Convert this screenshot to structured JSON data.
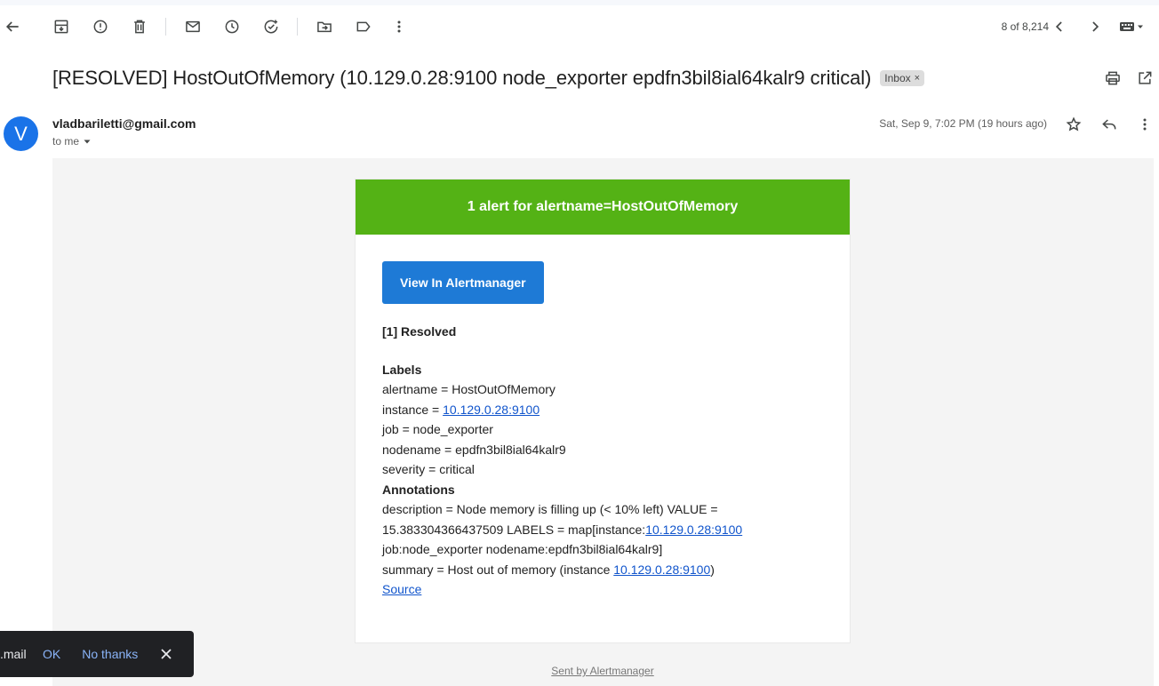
{
  "toolbar": {
    "pager_text": "8 of 8,214"
  },
  "message": {
    "subject": "[RESOLVED] HostOutOfMemory (10.129.0.28:9100 node_exporter epdfn3bil8ial64kalr9 critical)",
    "label": "Inbox",
    "label_remove": "×",
    "avatar_letter": "V",
    "sender": "vladbariletti@gmail.com",
    "to": "to me",
    "date": "Sat, Sep 9, 7:02 PM (19 hours ago)"
  },
  "alert": {
    "header": "1 alert for alertname=HostOutOfMemory",
    "button": "View In Alertmanager",
    "resolved": "[1] Resolved",
    "labels_heading": "Labels",
    "alertname_line": "alertname = HostOutOfMemory",
    "instance_prefix": "instance = ",
    "instance_link": "10.129.0.28:9100",
    "job_line": "job = node_exporter",
    "nodename_line": "nodename = epdfn3bil8ial64kalr9",
    "severity_line": "severity = critical",
    "annotations_heading": "Annotations",
    "description_1": "description = Node memory is filling up (< 10% left) VALUE =",
    "description_2_prefix": "15.383304366437509 LABELS = map[instance:",
    "description_2_link": "10.129.0.28:9100",
    "description_3": "job:node_exporter nodename:epdfn3bil8ial64kalr9]",
    "summary_prefix": "summary = Host out of memory (instance ",
    "summary_link": "10.129.0.28:9100",
    "summary_suffix": ")",
    "source_link": "Source",
    "footer": "Sent by Alertmanager"
  },
  "snackbar": {
    "text": "mail.",
    "ok": "OK",
    "no_thanks": "No thanks"
  },
  "colors": {
    "alert_header": "#54b215",
    "button": "#1e7ad6",
    "avatar": "#1a73e8"
  }
}
